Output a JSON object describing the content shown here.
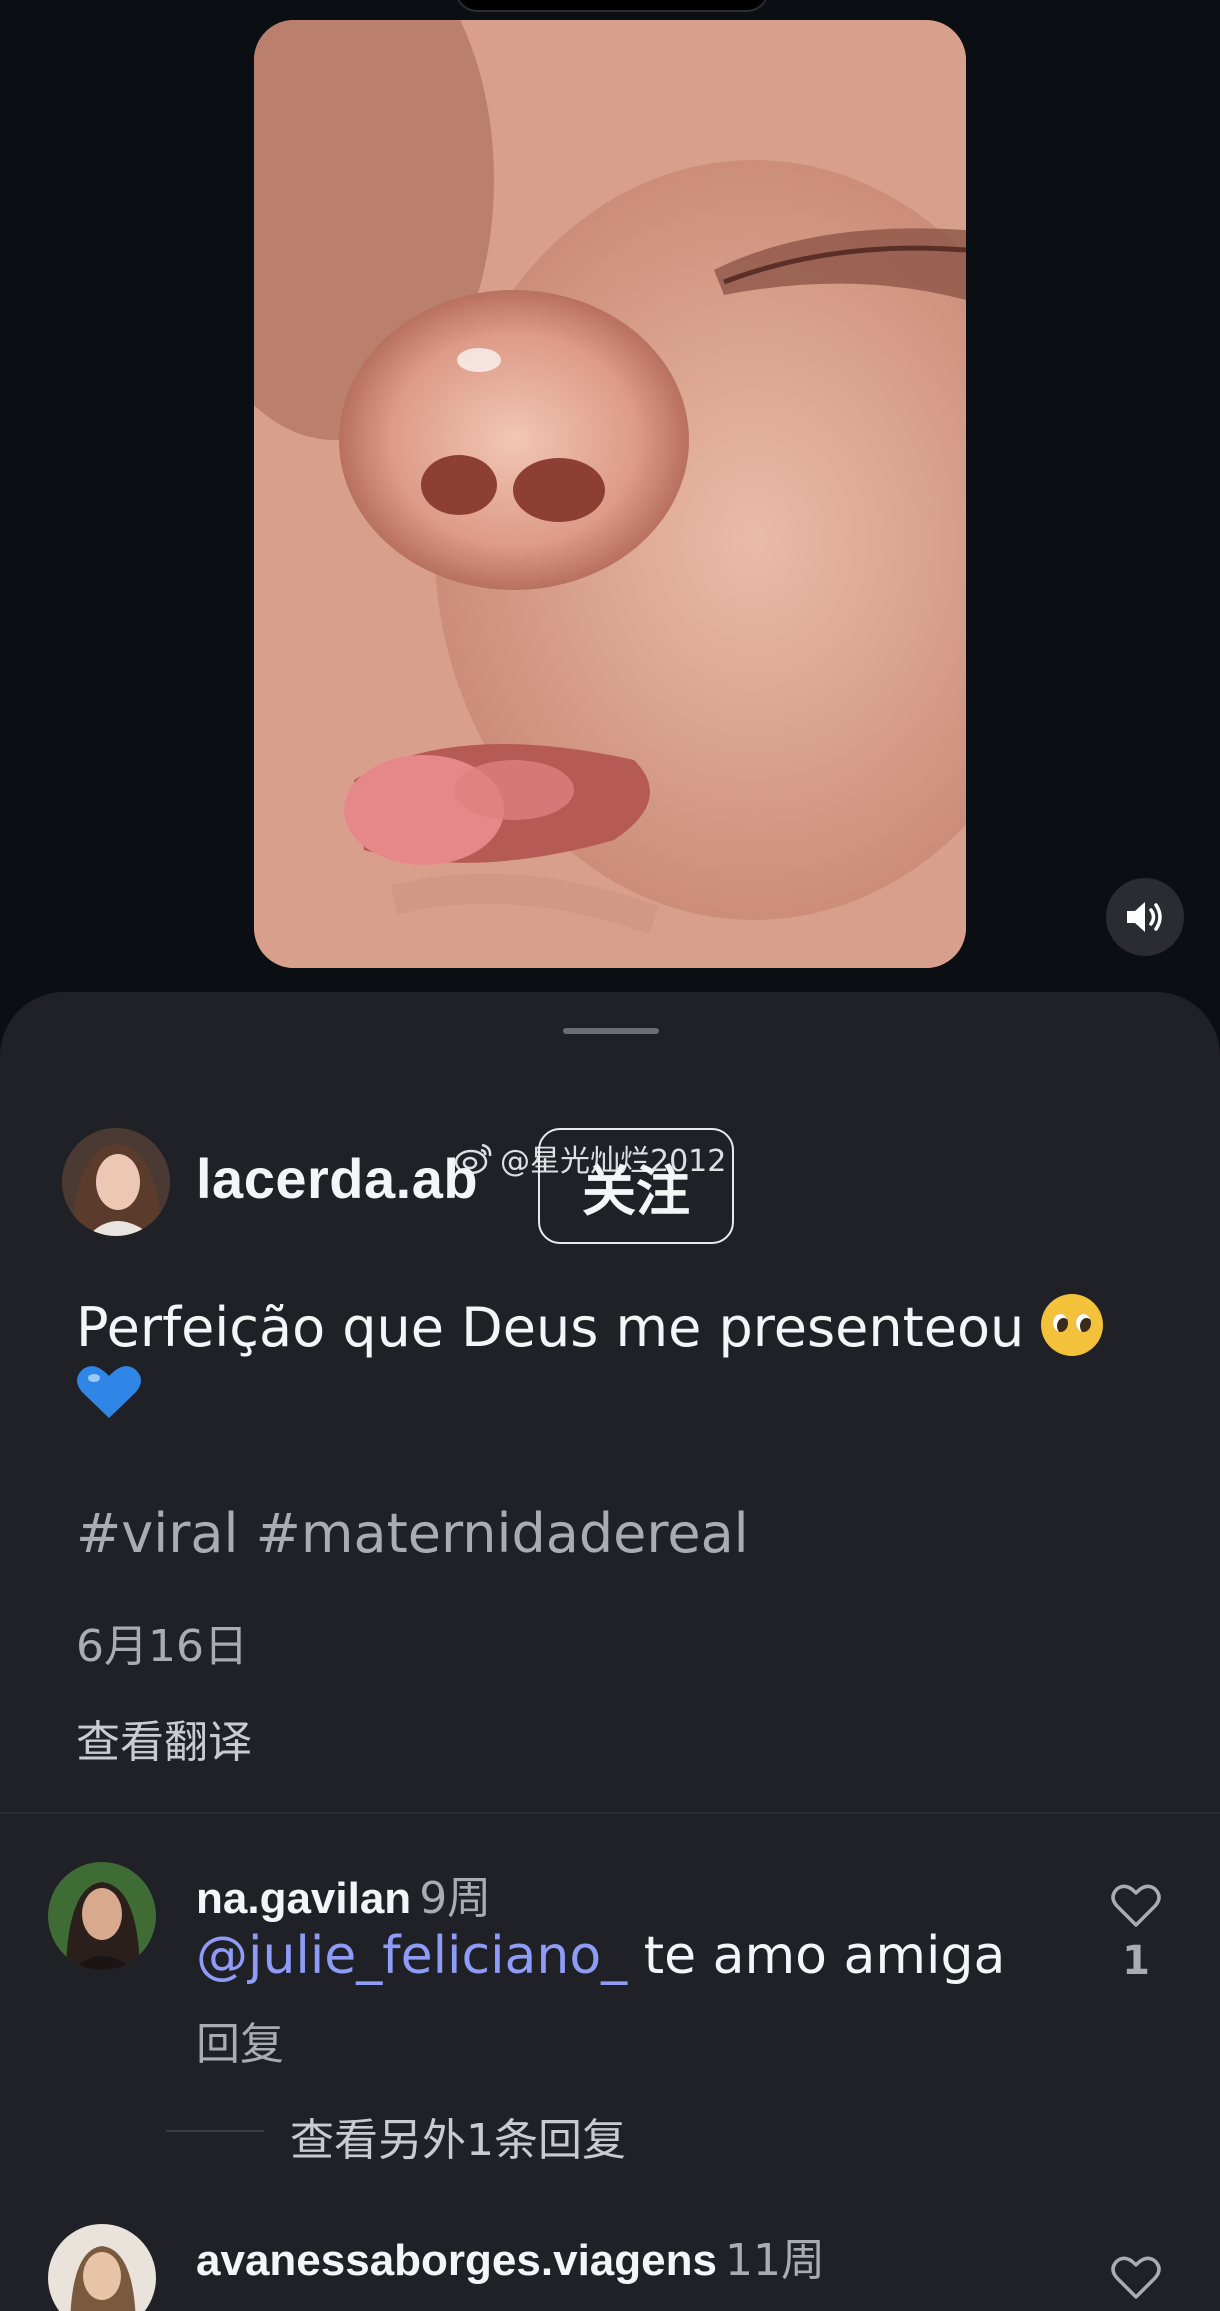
{
  "post": {
    "author": "lacerda.ab",
    "follow_label": "关注",
    "watermark": "@星光灿烂2012",
    "caption": "Perfeição que Deus me presenteou",
    "hashtags": "#viral #maternidadereal",
    "date": "6月16日",
    "translate_label": "查看翻译"
  },
  "comments": [
    {
      "username": "na.gavilan",
      "time": "9周",
      "mention": "@julie_feliciano_",
      "text": " te amo amiga",
      "reply_label": "回复",
      "likes": "1",
      "more_replies": "查看另外1条回复"
    },
    {
      "username": "avanessaborges.viagens",
      "time": "11周"
    }
  ],
  "icons": {
    "mute": "speaker-icon",
    "like": "heart-icon",
    "watermark": "weibo-icon"
  },
  "colors": {
    "background": "#0b0f14",
    "sheet": "#1f2126",
    "mention": "#8f9cf7",
    "secondary_text": "#a9acb2"
  }
}
